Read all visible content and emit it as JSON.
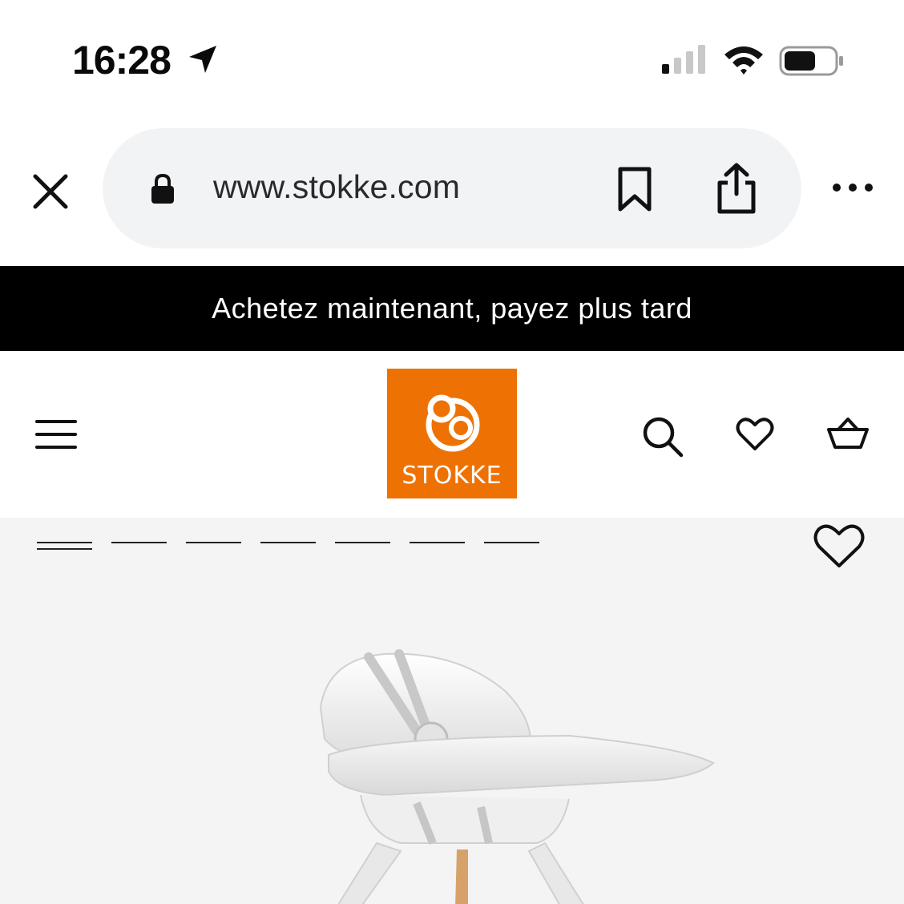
{
  "status_bar": {
    "time": "16:28",
    "icons": [
      "location-arrow-icon",
      "cellular-signal-icon",
      "wifi-icon",
      "battery-icon"
    ]
  },
  "browser": {
    "url": "www.stokke.com",
    "icons": [
      "close-icon",
      "lock-icon",
      "bookmark-icon",
      "share-icon",
      "more-icon"
    ]
  },
  "promo_banner": {
    "text": "Achetez maintenant, payez plus tard"
  },
  "header": {
    "logo_text": "STOKKE",
    "brand_color": "#ee7203",
    "icons": [
      "menu-icon",
      "search-icon",
      "heart-icon",
      "basket-icon"
    ]
  },
  "gallery": {
    "slide_count": 7,
    "active_slide": 1,
    "product_icon": "high-chair-image",
    "favorite_icon": "heart-outline-icon"
  }
}
